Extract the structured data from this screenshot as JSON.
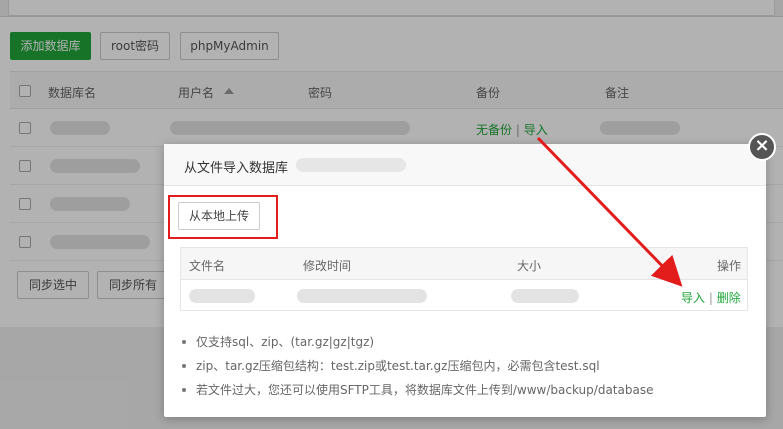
{
  "toolbar": {
    "add_db": "添加数据库",
    "root_pwd": "root密码",
    "phpmyadmin": "phpMyAdmin"
  },
  "table": {
    "headers": {
      "name": "数据库名",
      "user": "用户名",
      "password": "密码",
      "backup": "备份",
      "note": "备注"
    },
    "sort_icon": "sort-up-icon",
    "first_row": {
      "backup_status": "无备份",
      "separator": "|",
      "import_link": "导入"
    }
  },
  "bottom": {
    "sync_selected": "同步选中",
    "sync_all": "同步所有"
  },
  "modal": {
    "title": "从文件导入数据库",
    "upload_button": "从本地上传",
    "close_icon": "close-icon",
    "file_table": {
      "headers": {
        "name": "文件名",
        "mtime": "修改时间",
        "size": "大小",
        "actions": "操作"
      },
      "row": {
        "import": "导入",
        "separator": "|",
        "delete": "删除"
      }
    },
    "notes": [
      "仅支持sql、zip、(tar.gz|gz|tgz)",
      "zip、tar.gz压缩包结构：test.zip或test.tar.gz压缩包内，必需包含test.sql",
      "若文件过大，您还可以使用SFTP工具，将数据库文件上传到/www/backup/database"
    ]
  },
  "colors": {
    "accent_green": "#20a53a",
    "highlight_red": "#e31c1c",
    "overlay": "rgba(0,0,0,0.30)"
  }
}
